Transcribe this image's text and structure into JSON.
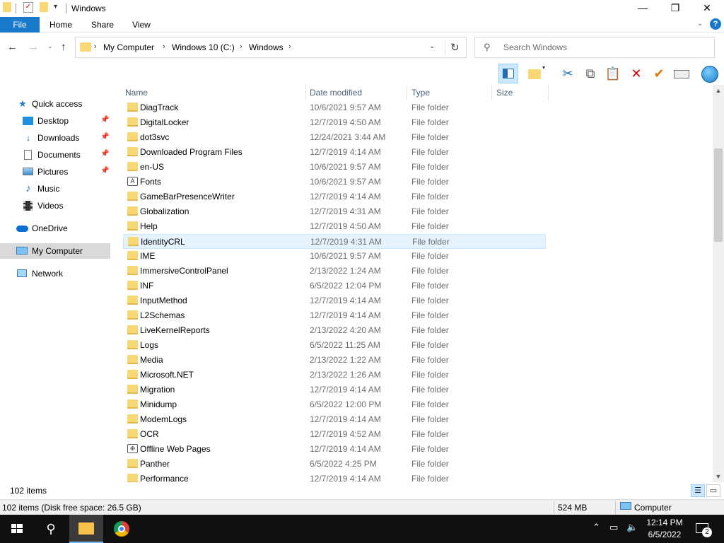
{
  "window": {
    "title": "Windows",
    "controls": {
      "minimize": "—",
      "maximize": "❐",
      "close": "✕"
    }
  },
  "ribbon": {
    "tabs": [
      "File",
      "Home",
      "Share",
      "View"
    ],
    "help": "?"
  },
  "address": {
    "crumbs": [
      "My Computer",
      "Windows 10 (C:)",
      "Windows"
    ],
    "search_placeholder": "Search Windows"
  },
  "toolbar": {
    "buttons": [
      "preview-pane-icon",
      "new-folder-icon",
      "cut-icon",
      "copy-icon",
      "paste-icon",
      "delete-icon",
      "rename-check-icon",
      "properties-icon",
      "globe-icon"
    ]
  },
  "nav": {
    "quick_access": "Quick access",
    "desktop": "Desktop",
    "downloads": "Downloads",
    "documents": "Documents",
    "pictures": "Pictures",
    "music": "Music",
    "videos": "Videos",
    "onedrive": "OneDrive",
    "my_computer": "My Computer",
    "network": "Network"
  },
  "columns": {
    "name": "Name",
    "date": "Date modified",
    "type": "Type",
    "size": "Size"
  },
  "files": [
    {
      "name": "DiagTrack",
      "date": "10/6/2021 9:57 AM",
      "type": "File folder"
    },
    {
      "name": "DigitalLocker",
      "date": "12/7/2019 4:50 AM",
      "type": "File folder"
    },
    {
      "name": "dot3svc",
      "date": "12/24/2021 3:44 AM",
      "type": "File folder"
    },
    {
      "name": "Downloaded Program Files",
      "date": "12/7/2019 4:14 AM",
      "type": "File folder"
    },
    {
      "name": "en-US",
      "date": "10/6/2021 9:57 AM",
      "type": "File folder"
    },
    {
      "name": "Fonts",
      "date": "10/6/2021 9:57 AM",
      "type": "File folder"
    },
    {
      "name": "GameBarPresenceWriter",
      "date": "12/7/2019 4:14 AM",
      "type": "File folder"
    },
    {
      "name": "Globalization",
      "date": "12/7/2019 4:31 AM",
      "type": "File folder"
    },
    {
      "name": "Help",
      "date": "12/7/2019 4:50 AM",
      "type": "File folder"
    },
    {
      "name": "IdentityCRL",
      "date": "12/7/2019 4:31 AM",
      "type": "File folder"
    },
    {
      "name": "IME",
      "date": "10/6/2021 9:57 AM",
      "type": "File folder"
    },
    {
      "name": "ImmersiveControlPanel",
      "date": "2/13/2022 1:24 AM",
      "type": "File folder"
    },
    {
      "name": "INF",
      "date": "6/5/2022 12:04 PM",
      "type": "File folder"
    },
    {
      "name": "InputMethod",
      "date": "12/7/2019 4:14 AM",
      "type": "File folder"
    },
    {
      "name": "L2Schemas",
      "date": "12/7/2019 4:14 AM",
      "type": "File folder"
    },
    {
      "name": "LiveKernelReports",
      "date": "2/13/2022 4:20 AM",
      "type": "File folder"
    },
    {
      "name": "Logs",
      "date": "6/5/2022 11:25 AM",
      "type": "File folder"
    },
    {
      "name": "Media",
      "date": "2/13/2022 1:22 AM",
      "type": "File folder"
    },
    {
      "name": "Microsoft.NET",
      "date": "2/13/2022 1:26 AM",
      "type": "File folder"
    },
    {
      "name": "Migration",
      "date": "12/7/2019 4:14 AM",
      "type": "File folder"
    },
    {
      "name": "Minidump",
      "date": "6/5/2022 12:00 PM",
      "type": "File folder"
    },
    {
      "name": "ModemLogs",
      "date": "12/7/2019 4:14 AM",
      "type": "File folder"
    },
    {
      "name": "OCR",
      "date": "12/7/2019 4:52 AM",
      "type": "File folder"
    },
    {
      "name": "Offline Web Pages",
      "date": "12/7/2019 4:14 AM",
      "type": "File folder"
    },
    {
      "name": "Panther",
      "date": "6/5/2022 4:25 PM",
      "type": "File folder"
    },
    {
      "name": "Performance",
      "date": "12/7/2019 4:14 AM",
      "type": "File folder"
    }
  ],
  "selected_file": "IdentityCRL",
  "item_count": "102 items",
  "status": {
    "left": "102 items (Disk free space: 26.5 GB)",
    "size": "524 MB",
    "location": "Computer"
  },
  "taskbar": {
    "time": "12:14 PM",
    "date": "6/5/2022",
    "notifications": "2"
  },
  "colors": {
    "accent": "#1979ca",
    "folder": "#f8d775",
    "selection": "#e5f3ff"
  }
}
